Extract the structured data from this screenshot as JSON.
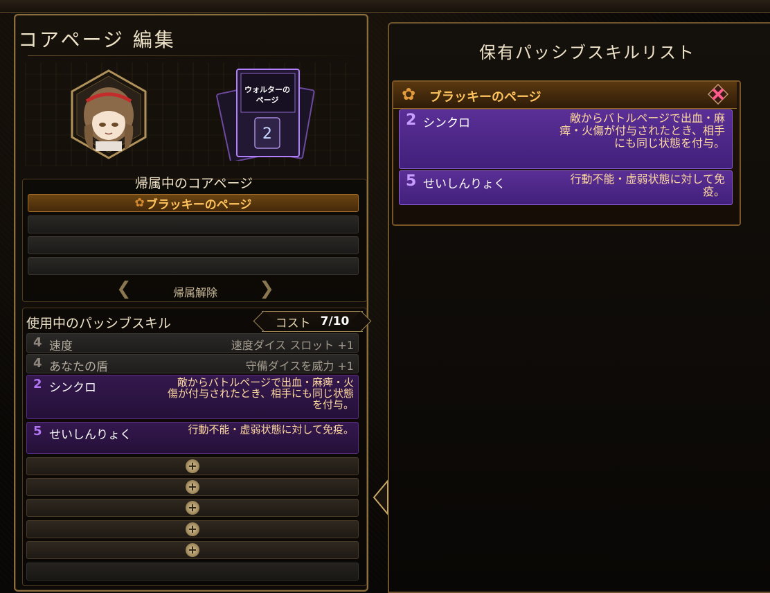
{
  "left_panel": {
    "title": "コアページ 編集",
    "core_page_card_title": "ウォルターの\nページ",
    "core_page_card_rank": "2",
    "attribution": {
      "header": "帰属中のコアページ",
      "active_page": "ブラッキーのページ",
      "release_button": "帰属解除"
    },
    "passive": {
      "title": "使用中のパッシブスキル",
      "cost_label": "コスト",
      "cost_value": "7/10",
      "skills": [
        {
          "cost": "4",
          "name": "速度",
          "desc": "速度ダイス スロット +1"
        },
        {
          "cost": "4",
          "name": "あなたの盾",
          "desc": "守備ダイスを威力 +1"
        },
        {
          "cost": "2",
          "name": "シンクロ",
          "desc": "敵からバトルページで出血・麻痺・火傷が付与されたとき、相手にも同じ状態を付与。"
        },
        {
          "cost": "5",
          "name": "せいしんりょく",
          "desc": "行動不能・虚弱状態に対して免疫。"
        }
      ]
    }
  },
  "right_panel": {
    "title": "保有パッシブスキルリスト",
    "card": {
      "page_name": "ブラッキーのページ",
      "skills": [
        {
          "cost": "2",
          "name": "シンクロ",
          "desc": "敵からバトルページで出血・麻痺・火傷が付与されたとき、相手にも同じ状態を付与。"
        },
        {
          "cost": "5",
          "name": "せいしんりょく",
          "desc": "行動不能・虚弱状態に対して免疫。"
        }
      ]
    }
  },
  "colors": {
    "gold_accent": "#ffc35e",
    "purple_skill": "#5a2f96",
    "frame": "#8c6f3e"
  },
  "icons": {
    "page_emblem": "clover-icon",
    "add_slot": "plus-icon",
    "close": "close-x-icon",
    "collapse": "chevron-left-icon"
  }
}
